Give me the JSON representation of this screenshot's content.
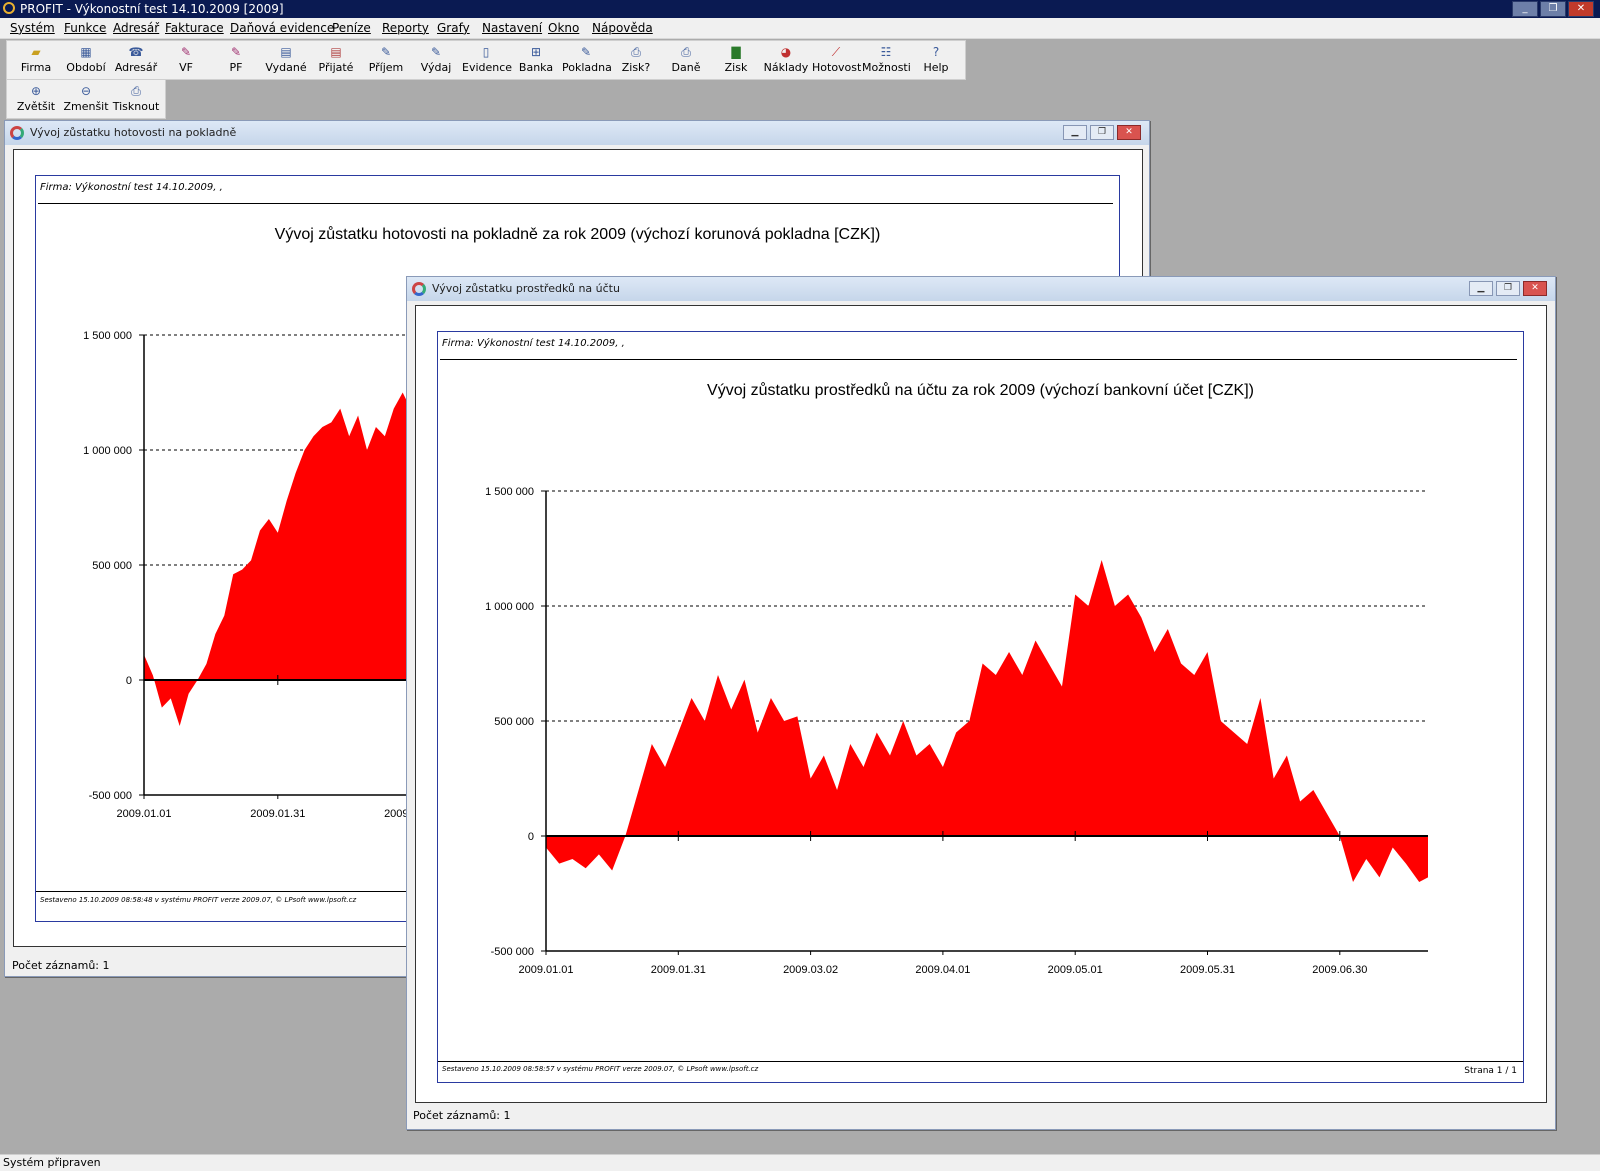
{
  "app": {
    "title": "PROFIT - Výkonostní test 14.10.2009 [2009]"
  },
  "menu": [
    "Systém",
    "Funkce",
    "Adresář",
    "Fakturace",
    "Daňová evidence",
    "Peníze",
    "Reporty",
    "Grafy",
    "Nastavení",
    "Okno",
    "Nápověda"
  ],
  "toolbar": {
    "row1": [
      {
        "label": "Firma",
        "icon": "folder-icon"
      },
      {
        "label": "Období",
        "icon": "calendar-icon"
      },
      {
        "label": "Adresář",
        "icon": "phone-icon"
      },
      {
        "label": "VF",
        "icon": "pen-icon"
      },
      {
        "label": "PF",
        "icon": "pen-icon"
      },
      {
        "label": "Vydané",
        "icon": "document-icon"
      },
      {
        "label": "Přijaté",
        "icon": "document-icon"
      },
      {
        "label": "Příjem",
        "icon": "pen-icon"
      },
      {
        "label": "Výdaj",
        "icon": "pen-icon"
      },
      {
        "label": "Evidence",
        "icon": "document-icon"
      },
      {
        "label": "Banka",
        "icon": "bank-icon"
      },
      {
        "label": "Pokladna",
        "icon": "cash-register-icon"
      },
      {
        "label": "Zisk?",
        "icon": "printer-icon"
      },
      {
        "label": "Daně",
        "icon": "printer-icon"
      },
      {
        "label": "Zisk",
        "icon": "bar-chart-icon"
      },
      {
        "label": "Náklady",
        "icon": "pie-chart-icon"
      },
      {
        "label": "Hotovost",
        "icon": "line-chart-icon"
      },
      {
        "label": "Možnosti",
        "icon": "options-icon"
      },
      {
        "label": "Help",
        "icon": "help-icon"
      }
    ],
    "row2": [
      {
        "label": "Zvětšit",
        "icon": "zoom-in-icon"
      },
      {
        "label": "Zmenšit",
        "icon": "zoom-out-icon"
      },
      {
        "label": "Tisknout",
        "icon": "printer-icon"
      }
    ]
  },
  "window1": {
    "caption": "Vývoj zůstatku hotovosti na pokladně",
    "firm": "Firma: Výkonostní test 14.10.2009,  ,",
    "footnote": "Sestaveno 15.10.2009 08:58:48 v systému PROFIT verze 2009.07, © LPsoft www.lpsoft.cz",
    "records": "Počet záznamů: 1"
  },
  "window2": {
    "caption": "Vývoj zůstatku prostředků na účtu",
    "firm": "Firma: Výkonostní test 14.10.2009,  ,",
    "footnote": "Sestaveno 15.10.2009 08:58:57 v systému PROFIT verze 2009.07, © LPsoft www.lpsoft.cz",
    "page": "Strana 1 / 1",
    "records": "Počet záznamů: 1"
  },
  "chart_data": [
    {
      "type": "area",
      "title": "Vývoj zůstatku hotovosti na pokladně za rok 2009 (výchozí korunová pokladna [CZK])",
      "color": "#ff0000",
      "ylim": [
        -500000,
        1500000
      ],
      "yticks": [
        -500000,
        0,
        500000,
        1000000,
        1500000
      ],
      "ytick_labels": [
        "-500 000",
        "0",
        "500 000",
        "1 000 000",
        "1 500 000"
      ],
      "xlim": [
        "2009-01-01",
        "2009-07-20"
      ],
      "xticks": [
        "2009-01-01",
        "2009-01-31",
        "2009-03-02"
      ],
      "xtick_labels": [
        "2009.01.01",
        "2009.01.31",
        "2009.03.02"
      ],
      "grid": "dashed-horizontal",
      "x": [
        "2009-01-01",
        "2009-01-03",
        "2009-01-05",
        "2009-01-07",
        "2009-01-09",
        "2009-01-11",
        "2009-01-13",
        "2009-01-15",
        "2009-01-17",
        "2009-01-19",
        "2009-01-21",
        "2009-01-23",
        "2009-01-25",
        "2009-01-27",
        "2009-01-29",
        "2009-01-31",
        "2009-02-02",
        "2009-02-04",
        "2009-02-06",
        "2009-02-08",
        "2009-02-10",
        "2009-02-12",
        "2009-02-14",
        "2009-02-16",
        "2009-02-18",
        "2009-02-20",
        "2009-02-22",
        "2009-02-24",
        "2009-02-26",
        "2009-02-28",
        "2009-03-02",
        "2009-03-04",
        "2009-03-06",
        "2009-03-08",
        "2009-03-10",
        "2009-03-12",
        "2009-03-14"
      ],
      "values": [
        110000,
        20000,
        -120000,
        -80000,
        -200000,
        -60000,
        0,
        70000,
        200000,
        280000,
        460000,
        480000,
        520000,
        650000,
        700000,
        640000,
        780000,
        900000,
        1000000,
        1060000,
        1100000,
        1120000,
        1180000,
        1060000,
        1150000,
        1000000,
        1100000,
        1060000,
        1180000,
        1250000,
        1170000,
        1300000,
        1200000,
        1320000,
        1250000,
        1300000,
        1350000
      ]
    },
    {
      "type": "area",
      "title": "Vývoj zůstatku prostředků na účtu za rok 2009 (výchozí bankovní účet [CZK])",
      "color": "#ff0000",
      "ylim": [
        -500000,
        1500000
      ],
      "yticks": [
        -500000,
        0,
        500000,
        1000000,
        1500000
      ],
      "ytick_labels": [
        "-500 000",
        "0",
        "500 000",
        "1 000 000",
        "1 500 000"
      ],
      "xlim": [
        "2009-01-01",
        "2009-07-20"
      ],
      "xticks": [
        "2009-01-01",
        "2009-01-31",
        "2009-03-02",
        "2009-04-01",
        "2009-05-01",
        "2009-05-31",
        "2009-06-30"
      ],
      "xtick_labels": [
        "2009.01.01",
        "2009.01.31",
        "2009.03.02",
        "2009.04.01",
        "2009.05.01",
        "2009.05.31",
        "2009.06.30"
      ],
      "grid": "dashed-horizontal",
      "x": [
        "2009-01-01",
        "2009-01-04",
        "2009-01-07",
        "2009-01-10",
        "2009-01-13",
        "2009-01-16",
        "2009-01-19",
        "2009-01-22",
        "2009-01-25",
        "2009-01-28",
        "2009-01-31",
        "2009-02-03",
        "2009-02-06",
        "2009-02-09",
        "2009-02-12",
        "2009-02-15",
        "2009-02-18",
        "2009-02-21",
        "2009-02-24",
        "2009-02-27",
        "2009-03-02",
        "2009-03-05",
        "2009-03-08",
        "2009-03-11",
        "2009-03-14",
        "2009-03-17",
        "2009-03-20",
        "2009-03-23",
        "2009-03-26",
        "2009-03-29",
        "2009-04-01",
        "2009-04-04",
        "2009-04-07",
        "2009-04-10",
        "2009-04-13",
        "2009-04-16",
        "2009-04-19",
        "2009-04-22",
        "2009-04-25",
        "2009-04-28",
        "2009-05-01",
        "2009-05-04",
        "2009-05-07",
        "2009-05-10",
        "2009-05-13",
        "2009-05-16",
        "2009-05-19",
        "2009-05-22",
        "2009-05-25",
        "2009-05-28",
        "2009-05-31",
        "2009-06-03",
        "2009-06-06",
        "2009-06-09",
        "2009-06-12",
        "2009-06-15",
        "2009-06-18",
        "2009-06-21",
        "2009-06-24",
        "2009-06-27",
        "2009-06-30",
        "2009-07-03",
        "2009-07-06",
        "2009-07-09",
        "2009-07-12",
        "2009-07-15",
        "2009-07-18",
        "2009-07-20"
      ],
      "values": [
        -50000,
        -120000,
        -100000,
        -140000,
        -80000,
        -150000,
        0,
        200000,
        400000,
        300000,
        450000,
        600000,
        500000,
        700000,
        550000,
        680000,
        450000,
        600000,
        500000,
        520000,
        250000,
        350000,
        200000,
        400000,
        300000,
        450000,
        350000,
        500000,
        350000,
        400000,
        300000,
        450000,
        500000,
        750000,
        700000,
        800000,
        700000,
        850000,
        750000,
        650000,
        1050000,
        1000000,
        1200000,
        1000000,
        1050000,
        950000,
        800000,
        900000,
        750000,
        700000,
        800000,
        500000,
        450000,
        400000,
        600000,
        250000,
        350000,
        150000,
        200000,
        100000,
        0,
        -200000,
        -100000,
        -180000,
        -50000,
        -120000,
        -200000,
        -180000
      ]
    }
  ],
  "status": {
    "text": "Systém připraven"
  }
}
